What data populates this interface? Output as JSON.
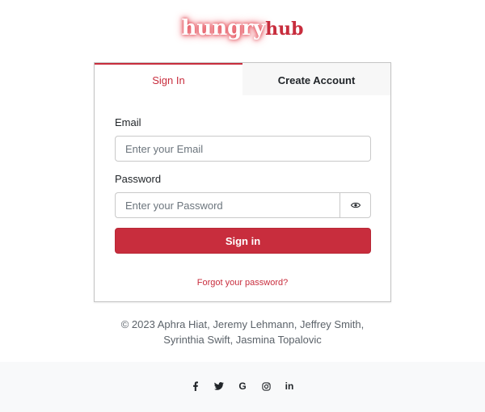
{
  "brand": {
    "part1": "hungry",
    "part2": "hub"
  },
  "tabs": [
    {
      "label": "Sign In",
      "active": true
    },
    {
      "label": "Create Account",
      "active": false
    }
  ],
  "form": {
    "email_label": "Email",
    "email_placeholder": "Enter your Email",
    "email_value": "",
    "password_label": "Password",
    "password_placeholder": "Enter your Password",
    "password_value": "",
    "submit_label": "Sign in",
    "forgot_label": "Forgot your password?"
  },
  "footer": {
    "copyright_line1": "© 2023 Aphra Hiat, Jeremy Lehmann, Jeffrey Smith,",
    "copyright_line2": "Syrinthia Swift, Jasmina Topalovic",
    "social": [
      {
        "icon": "facebook-icon",
        "glyph": "f"
      },
      {
        "icon": "twitter-icon",
        "glyph": ""
      },
      {
        "icon": "google-icon",
        "glyph": "G"
      },
      {
        "icon": "instagram-icon",
        "glyph": ""
      },
      {
        "icon": "linkedin-icon",
        "glyph": "in"
      }
    ]
  },
  "colors": {
    "accent": "#c82d3d",
    "footer_bg": "#f8f9fa",
    "inactive_tab_bg": "#f7f7f7"
  }
}
